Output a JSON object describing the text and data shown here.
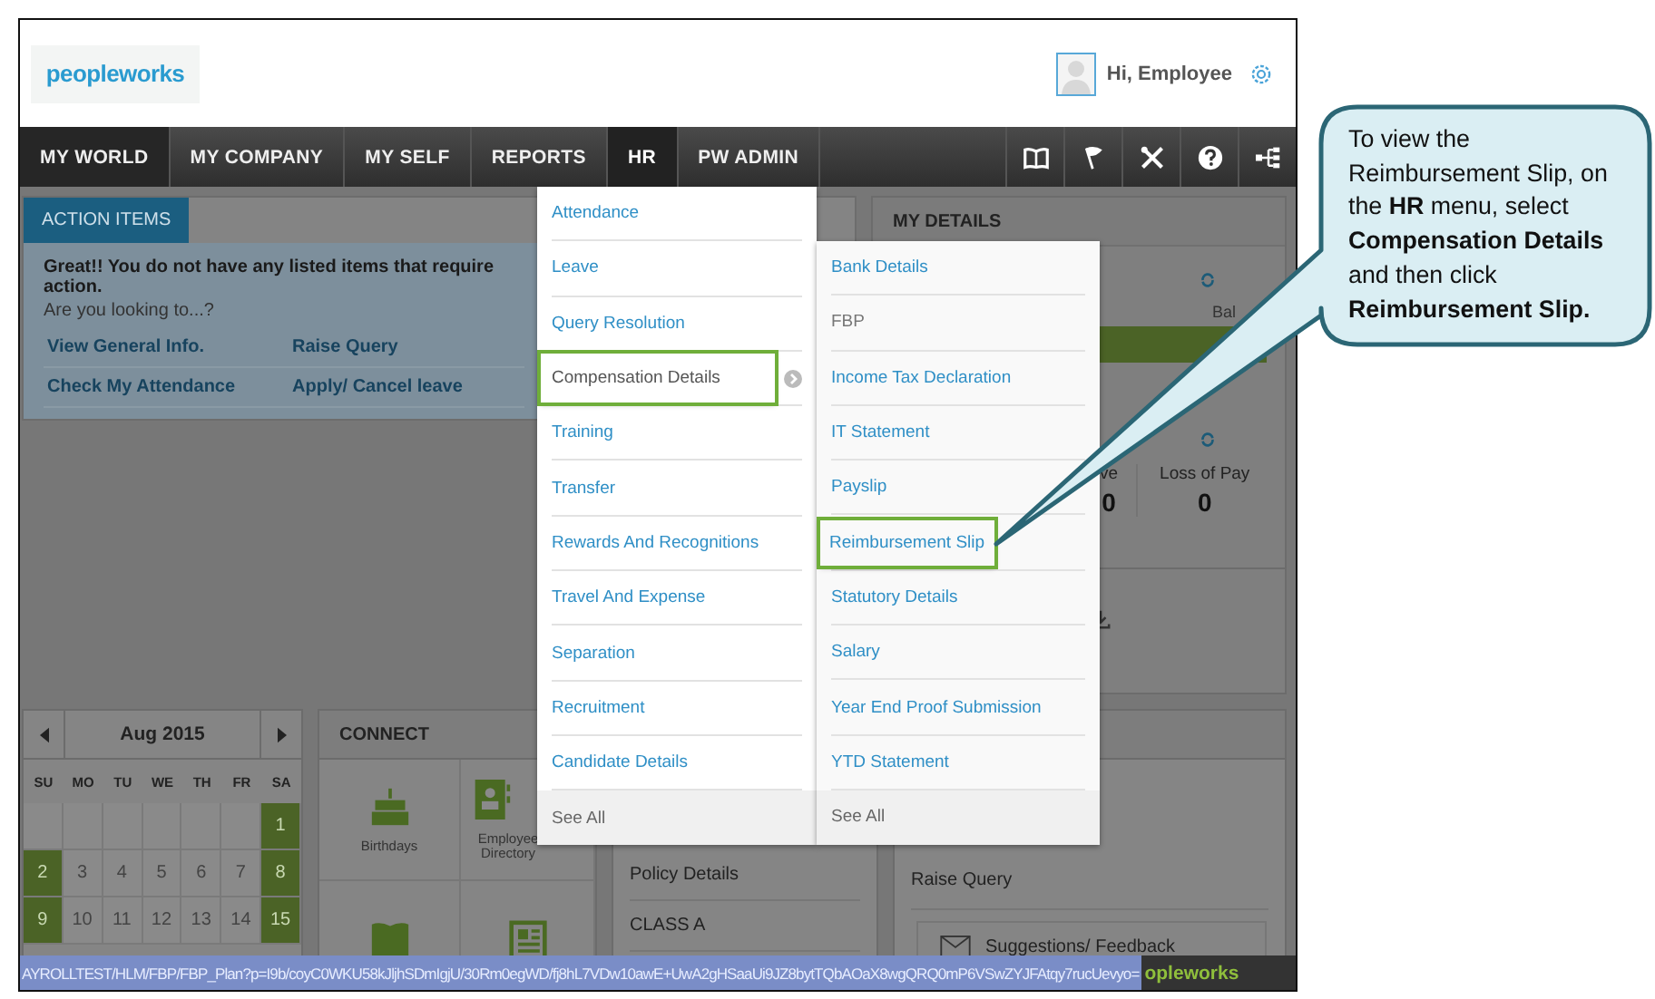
{
  "header": {
    "logo": "peopleworks",
    "greeting": "Hi, Employee"
  },
  "nav": [
    {
      "label": "MY WORLD",
      "selected": true,
      "open": false
    },
    {
      "label": "MY COMPANY",
      "selected": false,
      "open": false
    },
    {
      "label": "MY SELF",
      "selected": false,
      "open": false
    },
    {
      "label": "REPORTS",
      "selected": false,
      "open": false
    },
    {
      "label": "HR",
      "selected": false,
      "open": true
    },
    {
      "label": "PW ADMIN",
      "selected": false,
      "open": false
    }
  ],
  "action_items": {
    "tab": "ACTION ITEMS",
    "message": "Great!! You do not have any listed items that require action.",
    "prompt": "Are you looking to...?",
    "links": [
      "View General Info.",
      "Raise Query",
      "Check My Attendance",
      "Apply/ Cancel leave"
    ]
  },
  "my_details": {
    "title": "MY DETAILS",
    "balance_label": "Bal",
    "leave_label": "ve",
    "leave_value": "0",
    "loss_label": "Loss of Pay",
    "loss_value": "0"
  },
  "calendar": {
    "month": "Aug 2015",
    "weekdays": [
      "SU",
      "MO",
      "TU",
      "WE",
      "TH",
      "FR",
      "SA"
    ],
    "weeks": [
      [
        {
          "kind": "blank"
        },
        {
          "kind": "blank"
        },
        {
          "kind": "blank"
        },
        {
          "kind": "blank"
        },
        {
          "kind": "blank"
        },
        {
          "kind": "blank"
        },
        {
          "kind": "day",
          "day": "1",
          "weekend": true
        }
      ],
      [
        {
          "kind": "day",
          "day": "2",
          "weekend": true
        },
        {
          "kind": "day",
          "day": "3",
          "weekend": false
        },
        {
          "kind": "day",
          "day": "4",
          "weekend": false
        },
        {
          "kind": "day",
          "day": "5",
          "weekend": false
        },
        {
          "kind": "day",
          "day": "6",
          "weekend": false
        },
        {
          "kind": "day",
          "day": "7",
          "weekend": false
        },
        {
          "kind": "day",
          "day": "8",
          "weekend": true
        }
      ],
      [
        {
          "kind": "day",
          "day": "9",
          "weekend": true
        },
        {
          "kind": "day",
          "day": "10",
          "weekend": false
        },
        {
          "kind": "day",
          "day": "11",
          "weekend": false
        },
        {
          "kind": "day",
          "day": "12",
          "weekend": false
        },
        {
          "kind": "day",
          "day": "13",
          "weekend": false
        },
        {
          "kind": "day",
          "day": "14",
          "weekend": false
        },
        {
          "kind": "day",
          "day": "15",
          "weekend": true
        }
      ]
    ]
  },
  "connect": {
    "title": "CONNECT",
    "items": [
      {
        "label": "Birthdays",
        "kind": "cake"
      },
      {
        "label": "Employee Directory",
        "kind": "contact"
      }
    ]
  },
  "policy": {
    "items": [
      "Policy Details",
      "CLASS A"
    ]
  },
  "quick_links": {
    "items": [
      "Raise Query"
    ],
    "feedback": "Suggestions/ Feedback"
  },
  "hr_menu": {
    "items": [
      {
        "label": "Attendance",
        "highlighted": false,
        "has_submenu": false
      },
      {
        "label": "Leave",
        "highlighted": false,
        "has_submenu": false
      },
      {
        "label": "Query Resolution",
        "highlighted": false,
        "has_submenu": false
      },
      {
        "label": "Compensation Details",
        "highlighted": true,
        "has_submenu": true
      },
      {
        "label": "Training",
        "highlighted": false,
        "has_submenu": false
      },
      {
        "label": "Transfer",
        "highlighted": false,
        "has_submenu": false
      },
      {
        "label": "Rewards And Recognitions",
        "highlighted": false,
        "has_submenu": false
      },
      {
        "label": "Travel And Expense",
        "highlighted": false,
        "has_submenu": false
      },
      {
        "label": "Separation",
        "highlighted": false,
        "has_submenu": false
      },
      {
        "label": "Recruitment",
        "highlighted": false,
        "has_submenu": false
      },
      {
        "label": "Candidate Details",
        "highlighted": false,
        "has_submenu": false
      }
    ],
    "see_all": "See All"
  },
  "submenu": {
    "items": [
      {
        "label": "Bank Details",
        "highlighted": false,
        "disabled": false
      },
      {
        "label": "FBP",
        "highlighted": false,
        "disabled": true
      },
      {
        "label": "Income Tax Declaration",
        "highlighted": false,
        "disabled": false
      },
      {
        "label": "IT Statement",
        "highlighted": false,
        "disabled": false
      },
      {
        "label": "Payslip",
        "highlighted": false,
        "disabled": false
      },
      {
        "label": "Reimbursement Slip",
        "highlighted": true,
        "disabled": false
      },
      {
        "label": "Statutory Details",
        "highlighted": false,
        "disabled": false
      },
      {
        "label": "Salary",
        "highlighted": false,
        "disabled": false
      },
      {
        "label": "Year End Proof Submission",
        "highlighted": false,
        "disabled": false
      },
      {
        "label": "YTD Statement",
        "highlighted": false,
        "disabled": false
      }
    ],
    "see_all": "See All"
  },
  "status_bar": {
    "url": "AYROLLTEST/HLM/FBP/FBP_Plan?p=I9b/coyC0WKU58kJljhSDmIgjU/30Rm0egWD/fj8hL7VDw10awE+UwA2gHSaaUi9JZ8bytTQbAOaX8wgQRQ0mP6VSwZYJFAtqy7rucUevyo=",
    "logo": "opleworks"
  },
  "callout": {
    "text": "To view the Reimbursement Slip, on the **HR** menu, select **Compensation Details** and then click **Reimbursement Slip.**"
  }
}
